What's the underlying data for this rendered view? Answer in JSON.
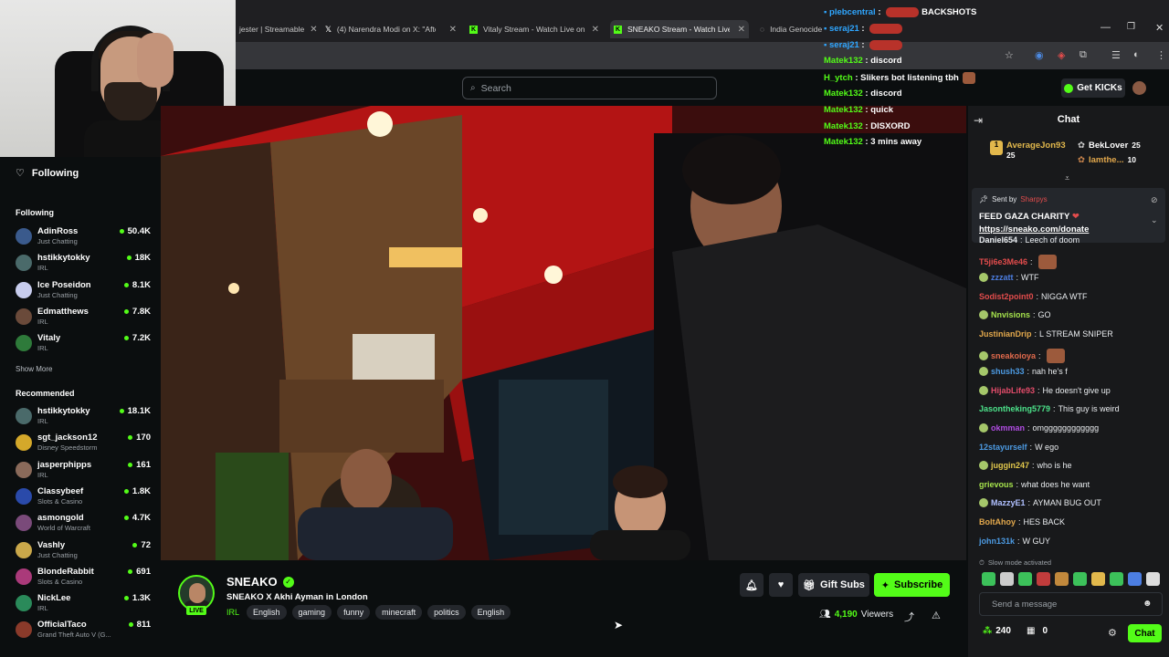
{
  "browser": {
    "tabs": [
      {
        "label": "jester | Streamable"
      },
      {
        "label": "(4) Narendra Modi on X: \"After"
      },
      {
        "label": "Vitaly Stream - Watch Live on K"
      },
      {
        "label": "SNEAKO Stream - Watch Live on K"
      },
      {
        "label": "India Genocide"
      }
    ]
  },
  "header": {
    "search_placeholder": "Search",
    "get_kicks": "Get KICKs"
  },
  "sidebar": {
    "following_header": "Following",
    "following_title": "Following",
    "following": [
      {
        "name": "AdinRoss",
        "category": "Just Chatting",
        "viewers": "50.4K",
        "color": "#3a5a8c"
      },
      {
        "name": "hstikkytokky",
        "category": "IRL",
        "viewers": "18K",
        "color": "#4a6a6a"
      },
      {
        "name": "Ice Poseidon",
        "category": "Just Chatting",
        "viewers": "8.1K",
        "color": "#c8cdee"
      },
      {
        "name": "Edmatthews",
        "category": "IRL",
        "viewers": "7.8K",
        "color": "#6a4a3a"
      },
      {
        "name": "Vitaly",
        "category": "IRL",
        "viewers": "7.2K",
        "color": "#2e7a3a"
      }
    ],
    "show_more": "Show More",
    "recommended_title": "Recommended",
    "recommended": [
      {
        "name": "hstikkytokky",
        "category": "IRL",
        "viewers": "18.1K",
        "color": "#4a6a6a"
      },
      {
        "name": "sgt_jackson12",
        "category": "Disney Speedstorm",
        "viewers": "170",
        "color": "#d4a82a"
      },
      {
        "name": "jasperphipps",
        "category": "IRL",
        "viewers": "161",
        "color": "#8a6a5a"
      },
      {
        "name": "Classybeef",
        "category": "Slots & Casino",
        "viewers": "1.8K",
        "color": "#2a4aaa"
      },
      {
        "name": "asmongold",
        "category": "World of Warcraft",
        "viewers": "4.7K",
        "color": "#7a4a7a"
      },
      {
        "name": "Vashly",
        "category": "Just Chatting",
        "viewers": "72",
        "color": "#caa84a"
      },
      {
        "name": "BlondeRabbit",
        "category": "Slots & Casino",
        "viewers": "691",
        "color": "#aa3a7a"
      },
      {
        "name": "NickLee",
        "category": "IRL",
        "viewers": "1.3K",
        "color": "#2a8a5a"
      },
      {
        "name": "OfficialTaco",
        "category": "Grand Theft Auto V (G...",
        "viewers": "811",
        "color": "#8a3a2a"
      }
    ]
  },
  "overlay_chat": [
    {
      "user": "plebcentral",
      "msg": "",
      "extra": "BACKSHOTS",
      "color": "blue"
    },
    {
      "user": "seraj21",
      "msg": "",
      "color": "blue"
    },
    {
      "user": "seraj21",
      "msg": "",
      "color": "blue"
    },
    {
      "user": "Matek132",
      "msg": "discord",
      "color": "green"
    },
    {
      "user": "H_ytch",
      "msg": "Slikers bot listening tbh",
      "color": "green"
    },
    {
      "user": "Matek132",
      "msg": "discord",
      "color": "green"
    },
    {
      "user": "Matek132",
      "msg": "quick",
      "color": "green"
    },
    {
      "user": "Matek132",
      "msg": "DISXORD",
      "color": "green"
    },
    {
      "user": "Matek132",
      "msg": "3 mins away",
      "color": "green"
    }
  ],
  "stream": {
    "live_badge": "LIVE",
    "streamer": "SNEAKO",
    "title": "SNEAKO X Akhi Ayman in London",
    "category": "IRL",
    "tags": [
      "English",
      "gaming",
      "funny",
      "minecraft",
      "politics",
      "English"
    ],
    "gift_subs": "Gift Subs",
    "subscribe": "Subscribe",
    "viewers": "4,190",
    "viewers_label": "Viewers"
  },
  "chat": {
    "title": "Chat",
    "gifters": [
      {
        "name": "AverageJon93",
        "count": "25"
      },
      {
        "name": "BekLover",
        "count": "25"
      },
      {
        "name": "Iamthe...",
        "count": "10"
      }
    ],
    "pinned": {
      "sent_by": "Sent by",
      "sender": "Sharpys",
      "message": "FEED GAZA CHARITY",
      "link": "https://sneako.com/donate"
    },
    "messages": [
      {
        "user": "Daniel654",
        "text": "Leech of doom",
        "color": "#e9ecef",
        "badge": false
      },
      {
        "user": "T5ji6e3Me46",
        "text": "",
        "color": "#e24c4c",
        "badge": false,
        "emote": true
      },
      {
        "user": "zzzatt",
        "text": "WTF",
        "color": "#4c7ee2",
        "badge": true
      },
      {
        "user": "Sodist2point0",
        "text": "NIGGA WTF",
        "color": "#e24c4c",
        "badge": false
      },
      {
        "user": "Nnvisions",
        "text": "GO",
        "color": "#a5e24c",
        "badge": true
      },
      {
        "user": "JustinianDrip",
        "text": "L STREAM SNIPER",
        "color": "#e2a84c",
        "badge": false
      },
      {
        "user": "sneakoioya",
        "text": "",
        "color": "#e26a4c",
        "badge": true,
        "emote": true
      },
      {
        "user": "shush33",
        "text": "nah he's f",
        "color": "#4c9ae2",
        "badge": true
      },
      {
        "user": "HijabLife93",
        "text": "He doesn't give up",
        "color": "#e24c6a",
        "badge": true
      },
      {
        "user": "Jasontheking5779",
        "text": "This guy is weird",
        "color": "#4ce28a",
        "badge": false
      },
      {
        "user": "okmman",
        "text": "omgggggggggggg",
        "color": "#b04ce2",
        "badge": true
      },
      {
        "user": "12stayurself",
        "text": "W ego",
        "color": "#4c9ae2",
        "badge": false
      },
      {
        "user": "juggin247",
        "text": "who is he",
        "color": "#e2c84c",
        "badge": true
      },
      {
        "user": "grievous",
        "text": "what does he want",
        "color": "#a5e24c",
        "badge": false
      },
      {
        "user": "MazzyE1",
        "text": "AYMAN BUG OUT",
        "color": "#b0c0ff",
        "badge": true
      },
      {
        "user": "BoltAhoy",
        "text": "HES BACK",
        "color": "#e2a84c",
        "badge": false
      },
      {
        "user": "john131k",
        "text": "W GUY",
        "color": "#4c9ae2",
        "badge": false
      }
    ],
    "slow_mode": "Slow mode activated",
    "send_placeholder": "Send a message",
    "kicks": "240",
    "gifts": "0",
    "chat_button": "Chat"
  }
}
